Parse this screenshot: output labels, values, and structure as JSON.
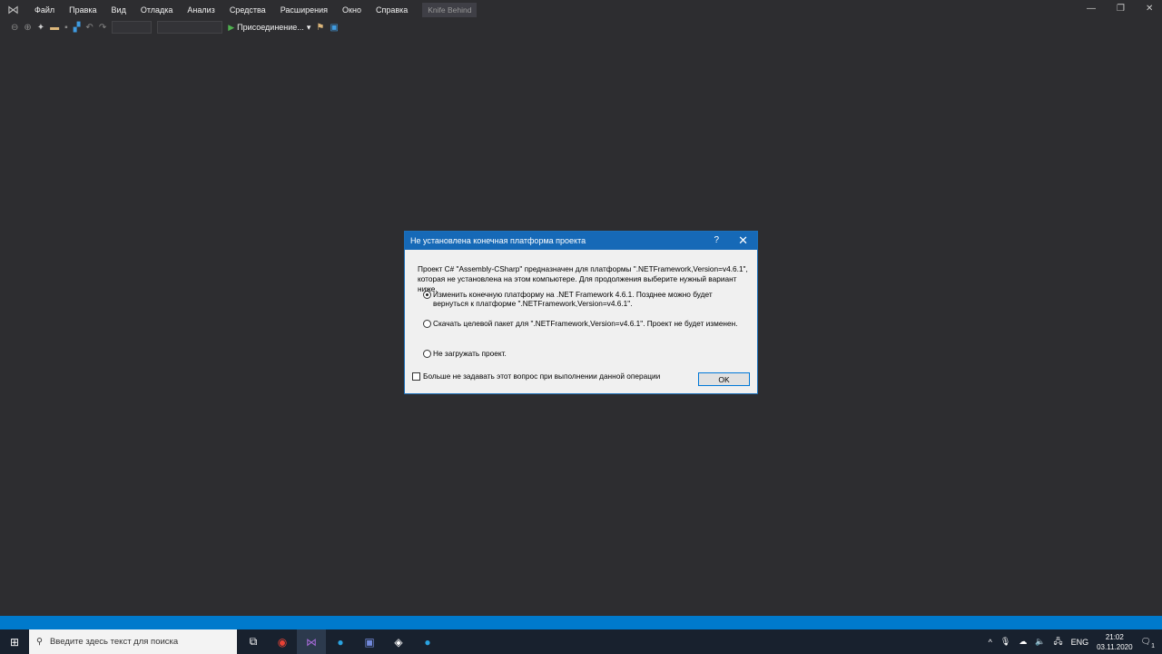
{
  "menubar": {
    "items": [
      "Файл",
      "Правка",
      "Вид",
      "Отладка",
      "Анализ",
      "Средства",
      "Расширения",
      "Окно",
      "Справка"
    ],
    "solution_title": "Knife Behind"
  },
  "toolbar": {
    "attach_label": "Присоединение..."
  },
  "dialog": {
    "title": "Не установлена конечная платформа проекта",
    "help": "?",
    "close": "✕",
    "message": "Проект C# \"Assembly-CSharp\" предназначен для платформы \".NETFramework,Version=v4.6.1\", которая не установлена на этом компьютере.  Для продолжения выберите нужный вариант ниже.",
    "options": [
      {
        "label": "Изменить конечную платформу на .NET Framework 4.6.1. Позднее можно будет вернуться к платформе \".NETFramework,Version=v4.6.1\".",
        "selected": true
      },
      {
        "label": "Скачать целевой пакет для \".NETFramework,Version=v4.6.1\". Проект не будет изменен.",
        "selected": false
      },
      {
        "label": "Не загружать проект.",
        "selected": false
      }
    ],
    "checkbox_label": "Больше не задавать этот вопрос при выполнении данной операции",
    "checkbox_checked": false,
    "ok_label": "OK"
  },
  "taskbar": {
    "search_placeholder": "Введите здесь текст для поиска",
    "language": "ENG",
    "time": "21:02",
    "date": "03.11.2020",
    "notification_count": "1"
  },
  "colors": {
    "background": "#2d2d30",
    "accent": "#007acc",
    "dialog_title": "#1669b7",
    "taskbar": "#18212e"
  }
}
